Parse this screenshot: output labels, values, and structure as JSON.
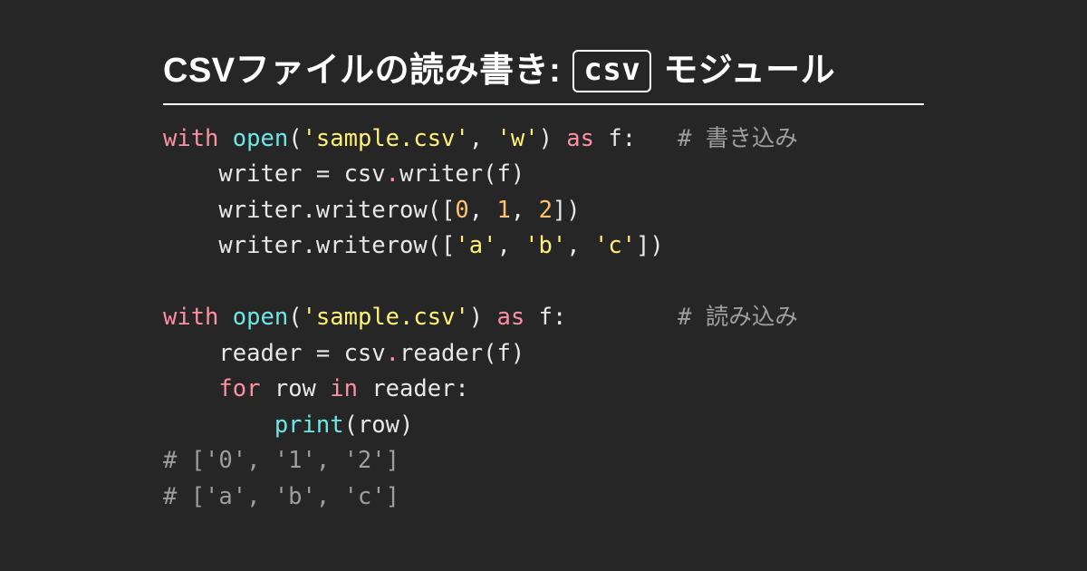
{
  "heading": {
    "pre": "CSVファイルの読み書き: ",
    "term": "csv",
    "post": " モジュール"
  },
  "code": {
    "tokens": [
      [
        {
          "t": "with",
          "c": "kw"
        },
        {
          "t": " ",
          "c": "pn"
        },
        {
          "t": "open",
          "c": "fn"
        },
        {
          "t": "(",
          "c": "pn"
        },
        {
          "t": "'sample.csv'",
          "c": "str"
        },
        {
          "t": ", ",
          "c": "pn"
        },
        {
          "t": "'w'",
          "c": "str"
        },
        {
          "t": ") ",
          "c": "pn"
        },
        {
          "t": "as",
          "c": "kw"
        },
        {
          "t": " f:   ",
          "c": "pn"
        },
        {
          "t": "# 書き込み",
          "c": "cmt"
        }
      ],
      [
        {
          "t": "    writer = csv",
          "c": "pn"
        },
        {
          "t": ".",
          "c": "dot"
        },
        {
          "t": "writer(f)",
          "c": "pn"
        }
      ],
      [
        {
          "t": "    writer.writerow([",
          "c": "pn"
        },
        {
          "t": "0",
          "c": "num"
        },
        {
          "t": ", ",
          "c": "pn"
        },
        {
          "t": "1",
          "c": "num"
        },
        {
          "t": ", ",
          "c": "pn"
        },
        {
          "t": "2",
          "c": "num"
        },
        {
          "t": "])",
          "c": "pn"
        }
      ],
      [
        {
          "t": "    writer.writerow([",
          "c": "pn"
        },
        {
          "t": "'a'",
          "c": "str"
        },
        {
          "t": ", ",
          "c": "pn"
        },
        {
          "t": "'b'",
          "c": "str"
        },
        {
          "t": ", ",
          "c": "pn"
        },
        {
          "t": "'c'",
          "c": "str"
        },
        {
          "t": "])",
          "c": "pn"
        }
      ],
      [],
      [
        {
          "t": "with",
          "c": "kw"
        },
        {
          "t": " ",
          "c": "pn"
        },
        {
          "t": "open",
          "c": "fn"
        },
        {
          "t": "(",
          "c": "pn"
        },
        {
          "t": "'sample.csv'",
          "c": "str"
        },
        {
          "t": ") ",
          "c": "pn"
        },
        {
          "t": "as",
          "c": "kw"
        },
        {
          "t": " f:        ",
          "c": "pn"
        },
        {
          "t": "# 読み込み",
          "c": "cmt"
        }
      ],
      [
        {
          "t": "    reader = csv",
          "c": "pn"
        },
        {
          "t": ".",
          "c": "dot"
        },
        {
          "t": "reader(f)",
          "c": "pn"
        }
      ],
      [
        {
          "t": "    ",
          "c": "pn"
        },
        {
          "t": "for",
          "c": "kw"
        },
        {
          "t": " row ",
          "c": "pn"
        },
        {
          "t": "in",
          "c": "kw"
        },
        {
          "t": " reader:",
          "c": "pn"
        }
      ],
      [
        {
          "t": "        ",
          "c": "pn"
        },
        {
          "t": "print",
          "c": "fn"
        },
        {
          "t": "(row)",
          "c": "pn"
        }
      ],
      [
        {
          "t": "# ['0', '1', '2']",
          "c": "cmt"
        }
      ],
      [
        {
          "t": "# ['a', 'b', 'c']",
          "c": "cmt"
        }
      ]
    ]
  }
}
